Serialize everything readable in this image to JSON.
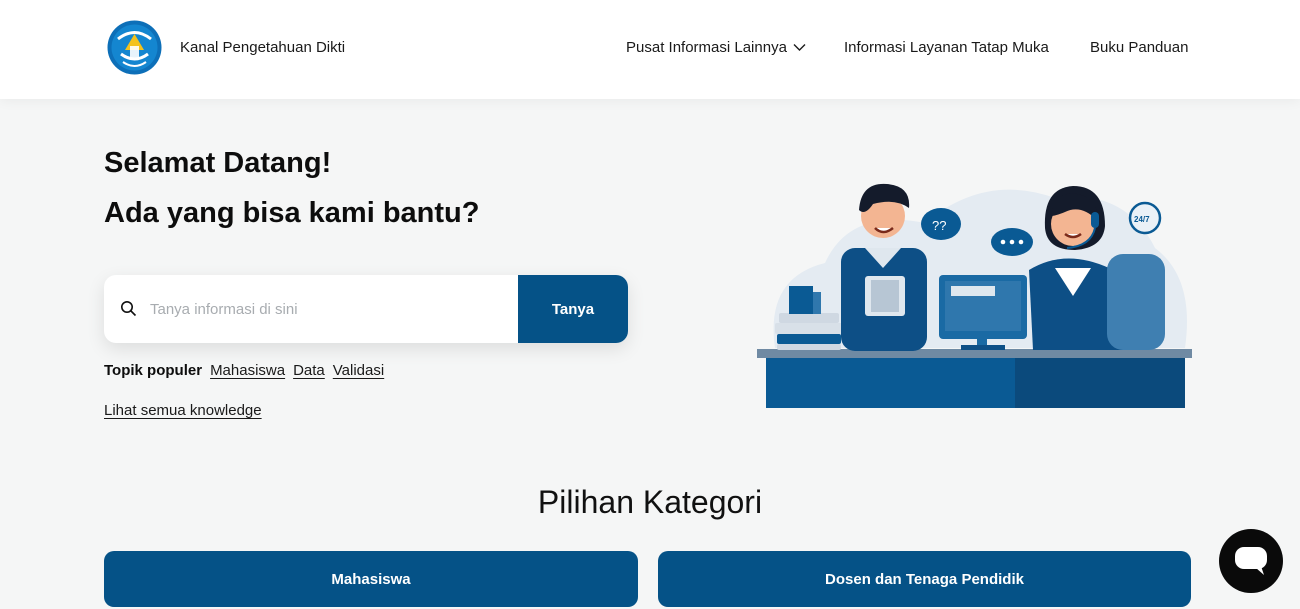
{
  "header": {
    "brand": "Kanal Pengetahuan Dikti",
    "nav": [
      {
        "label": "Pusat Informasi Lainnya"
      },
      {
        "label": "Informasi Layanan Tatap Muka"
      },
      {
        "label": "Buku Panduan"
      }
    ]
  },
  "hero": {
    "title_line1": "Selamat Datang!",
    "title_line2": "Ada yang bisa kami bantu?"
  },
  "search": {
    "placeholder": "Tanya informasi di sini",
    "value": "",
    "button_label": "Tanya"
  },
  "popular": {
    "label": "Topik populer",
    "topics": [
      "Mahasiswa",
      "Data",
      "Validasi"
    ]
  },
  "see_all_label": "Lihat semua knowledge",
  "categories": {
    "title": "Pilihan Kategori",
    "items": [
      {
        "label": "Mahasiswa"
      },
      {
        "label": "Dosen dan Tenaga Pendidik"
      }
    ]
  },
  "illustration": {
    "bubble_text": "??",
    "clock_text": "24/7"
  },
  "colors": {
    "primary": "#055287",
    "background": "#f5f6f6",
    "header_bg": "#ffffff",
    "chat_fab": "#0a0a0a"
  },
  "icons": [
    "logo-emblem",
    "chevron-down-icon",
    "search-icon",
    "chat-icon"
  ]
}
